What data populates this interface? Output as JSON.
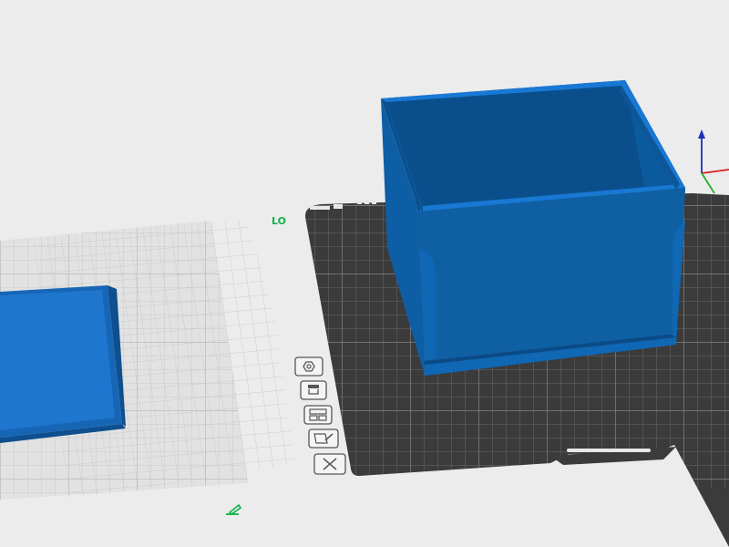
{
  "viewport": {
    "background": "#ececec"
  },
  "plates": [
    {
      "label": "",
      "state": "inactive",
      "color": "#dcdcdc"
    },
    {
      "label": "LO",
      "state": "active",
      "color": "#3a3a3a"
    }
  ],
  "models": [
    {
      "name": "lid",
      "color": "#1a6fc4"
    },
    {
      "name": "box",
      "color": "#0f5fa3"
    }
  ],
  "plate_toolbar": {
    "icons": [
      {
        "name": "arrange-icon"
      },
      {
        "name": "filament-icon"
      },
      {
        "name": "plate-settings-icon"
      },
      {
        "name": "edit-plate-icon"
      },
      {
        "name": "remove-plate-icon"
      }
    ]
  },
  "axis": {
    "z_color": "#1f2fbf",
    "x_color": "#d62020",
    "y_color": "#1db32c"
  },
  "colors": {
    "accent_green": "#0fb34a",
    "icon_stroke": "#555555"
  }
}
